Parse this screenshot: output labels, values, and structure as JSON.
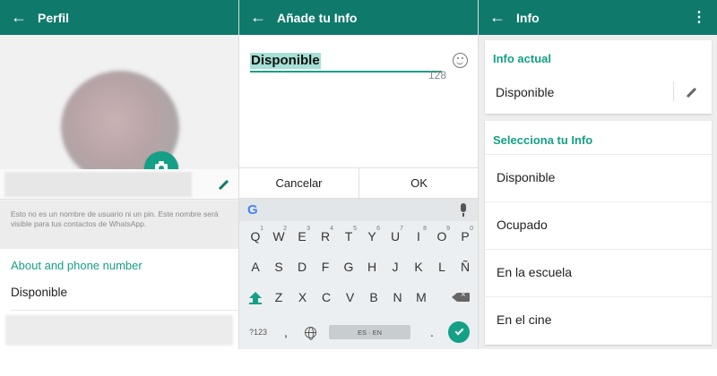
{
  "profile": {
    "title": "Perfil",
    "hint": "Esto no es un nombre de usuario ni un pin. Este nombre será visible para tus contactos de WhatsApp.",
    "about_title": "About and phone number",
    "about_value": "Disponible"
  },
  "edit": {
    "title": "Añade tu Info",
    "status_value": "Disponible",
    "counter": "128",
    "cancel_label": "Cancelar",
    "ok_label": "OK"
  },
  "keyboard": {
    "row1": [
      {
        "k": "Q",
        "d": "1"
      },
      {
        "k": "W",
        "d": "2"
      },
      {
        "k": "E",
        "d": "3"
      },
      {
        "k": "R",
        "d": "4"
      },
      {
        "k": "T",
        "d": "5"
      },
      {
        "k": "Y",
        "d": "6"
      },
      {
        "k": "U",
        "d": "7"
      },
      {
        "k": "I",
        "d": "8"
      },
      {
        "k": "O",
        "d": "9"
      },
      {
        "k": "P",
        "d": "0"
      }
    ],
    "row2": [
      "A",
      "S",
      "D",
      "F",
      "G",
      "H",
      "J",
      "K",
      "L",
      "Ñ"
    ],
    "row3": [
      "Z",
      "X",
      "C",
      "V",
      "B",
      "N",
      "M"
    ],
    "symbols_label": "?123",
    "comma_label": ",",
    "space_label": "ES · EN",
    "period_label": "."
  },
  "info": {
    "title": "Info",
    "current_title": "Info actual",
    "current_value": "Disponible",
    "select_title": "Selecciona tu Info",
    "options": [
      "Disponible",
      "Ocupado",
      "En la escuela",
      "En el cine"
    ]
  },
  "colors": {
    "appbar": "#0f7a6c",
    "accent": "#14a086"
  },
  "icons": [
    "back-arrow-icon",
    "camera-icon",
    "pencil-icon",
    "smiley-icon",
    "google-icon",
    "mic-icon",
    "shift-icon",
    "backspace-icon",
    "globe-icon",
    "check-icon",
    "more-vert-icon"
  ]
}
